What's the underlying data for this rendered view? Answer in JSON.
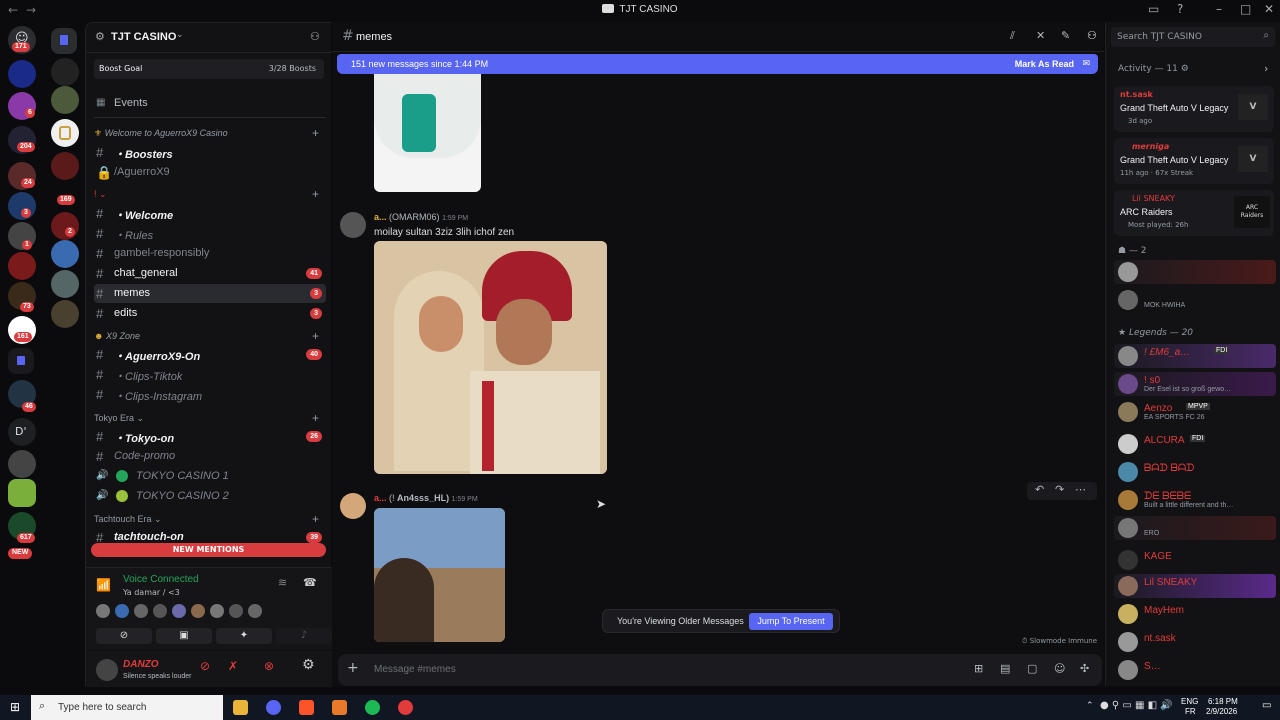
{
  "window": {
    "title": "TJT CASINO",
    "back": "←",
    "forward": "→"
  },
  "rail": {
    "badges": [
      "171",
      "6",
      "204",
      "24",
      "169",
      "2",
      "46",
      "617",
      "NEW",
      "161",
      "3",
      "1",
      "73"
    ],
    "letter_server": "D'"
  },
  "guild": {
    "name": "TJT CASINO",
    "boost_label": "Boost Goal",
    "boost_count": "3/28 Boosts",
    "events_label": "Events"
  },
  "channels": [
    {
      "name": "Welcome to AguerroX9 Casino",
      "type": "category"
    },
    {
      "name": "・Boosters",
      "icon": "🚀"
    },
    {
      "name": "/AguerroX9",
      "icon": "🔒"
    },
    {
      "name": "・Welcome",
      "icon": "🇦🇷"
    },
    {
      "name": "・Rules",
      "icon": "📜"
    },
    {
      "name": "gambel-responsibly",
      "icon": "🔞"
    },
    {
      "name": "chat_general",
      "count": "41"
    },
    {
      "name": "memes",
      "count": "3"
    },
    {
      "name": "edits",
      "count": "3"
    },
    {
      "name": "X9 Zone",
      "type": "category"
    },
    {
      "name": "・AguerroX9-On",
      "count": "40",
      "icon": "👑"
    },
    {
      "name": "・Clips-Tiktok",
      "icon": "📼"
    },
    {
      "name": "・Clips-Instagram",
      "icon": "🖼"
    },
    {
      "name": "Tokyo Era",
      "type": "category"
    },
    {
      "name": "・Tokyo-on",
      "count": "26",
      "icon": "📢"
    },
    {
      "name": "Code-promo",
      "icon": "💸"
    },
    {
      "name": "TOKYO CASINO 1"
    },
    {
      "name": "TOKYO CASINO 2"
    },
    {
      "name": "Tachtouch Era",
      "type": "category"
    },
    {
      "name": "tachtouch-on",
      "count": "39"
    }
  ],
  "new_mentions": "NEW MENTIONS",
  "voice": {
    "status": "Voice Connected",
    "channel": "Ya damar / <3"
  },
  "user": {
    "name": "DANZO",
    "status": "Silence speaks louder"
  },
  "main": {
    "channel": "memes",
    "new_messages": "151 new messages since 1:44 PM",
    "mark_read": "Mark As Read",
    "messages": [
      {
        "author": "a...",
        "tag": "(OMARM06)",
        "time": "1:59 PM",
        "text": "moilay sultan 3ziz 3lih ichof zen"
      },
      {
        "author": "a...",
        "tag": "An4sss_HL)",
        "time": "1:59 PM"
      }
    ],
    "older_text": "You're Viewing Older Messages",
    "jump": "Jump To Present",
    "slowmode": "Slowmode Immune",
    "composer_placeholder": "Message #memes"
  },
  "members": {
    "search_placeholder": "Search TJT CASINO",
    "activity_header": "Activity — 11",
    "activities": [
      {
        "user": "nt.sask",
        "game": "Grand Theft Auto V Legacy",
        "meta": "3d ago"
      },
      {
        "user": "merniga",
        "game": "Grand Theft Auto V Legacy",
        "meta": "11h ago · 67x Streak"
      },
      {
        "user": "Lil SNEAKY",
        "game": "ARC Raiders",
        "meta": "Most played: 26h",
        "art": "ARC Raiders"
      }
    ],
    "group2": "— 2",
    "group2_members": [
      {
        "name": "",
        "status": ""
      },
      {
        "name": "",
        "status": "MOK HWIHA"
      }
    ],
    "legends_header": "Legends — 20",
    "legends": [
      {
        "name": "! £M6_a…",
        "status": "",
        "tag": "FDI"
      },
      {
        "name": "! s0",
        "status": "Der Esel ist so groß gewo…"
      },
      {
        "name": "Aenzo",
        "status": "EA SPORTS FC 26",
        "tag": "MPVP"
      },
      {
        "name": "ALCURA",
        "status": "",
        "tag": "FDI"
      },
      {
        "name": "ᗷᗩᗪ ᗷᗩᗪ",
        "status": ""
      },
      {
        "name": "ᗪᗴ ᗷᗴᗷᗴ",
        "status": "Built a little different and th…"
      },
      {
        "name": "",
        "status": "ERO"
      },
      {
        "name": "KAGE",
        "status": ""
      },
      {
        "name": "Lil SNEAKY",
        "status": ""
      },
      {
        "name": "MayHem",
        "status": ""
      },
      {
        "name": "nt.sask",
        "status": ""
      },
      {
        "name": "S…",
        "status": ""
      }
    ]
  },
  "taskbar": {
    "search": "Type here to search",
    "lang": "ENG",
    "region": "FR",
    "time": "6:18 PM",
    "date": "2/9/2026"
  },
  "colors": {
    "accent": "#5865f2",
    "red": "#d83c3e",
    "green": "#23a55a",
    "name_red": "#e23b3b",
    "gold": "#e0b13a"
  }
}
